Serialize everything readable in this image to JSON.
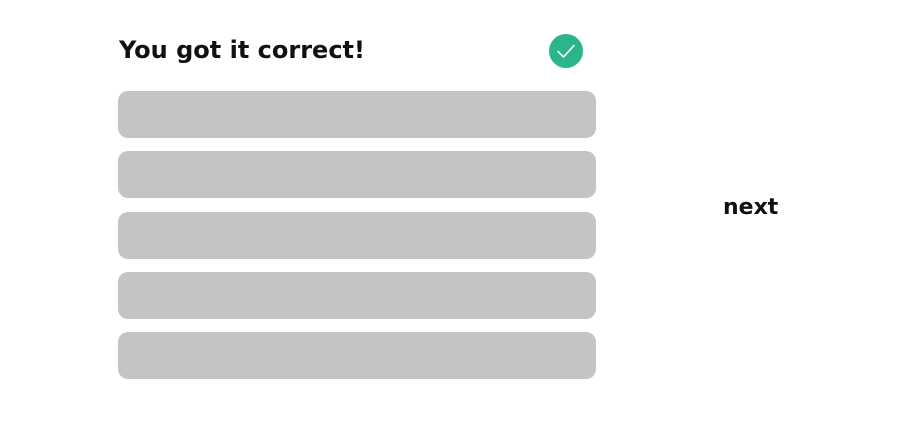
{
  "feedback": {
    "message": "You got it correct!",
    "status_icon": "checkmark-icon",
    "status_color": "#2bb58a"
  },
  "options": {
    "count": 5,
    "color": "#c4c4c4",
    "items": [
      {
        "label": ""
      },
      {
        "label": ""
      },
      {
        "label": ""
      },
      {
        "label": ""
      },
      {
        "label": ""
      }
    ]
  },
  "navigation": {
    "next_label": "next"
  }
}
